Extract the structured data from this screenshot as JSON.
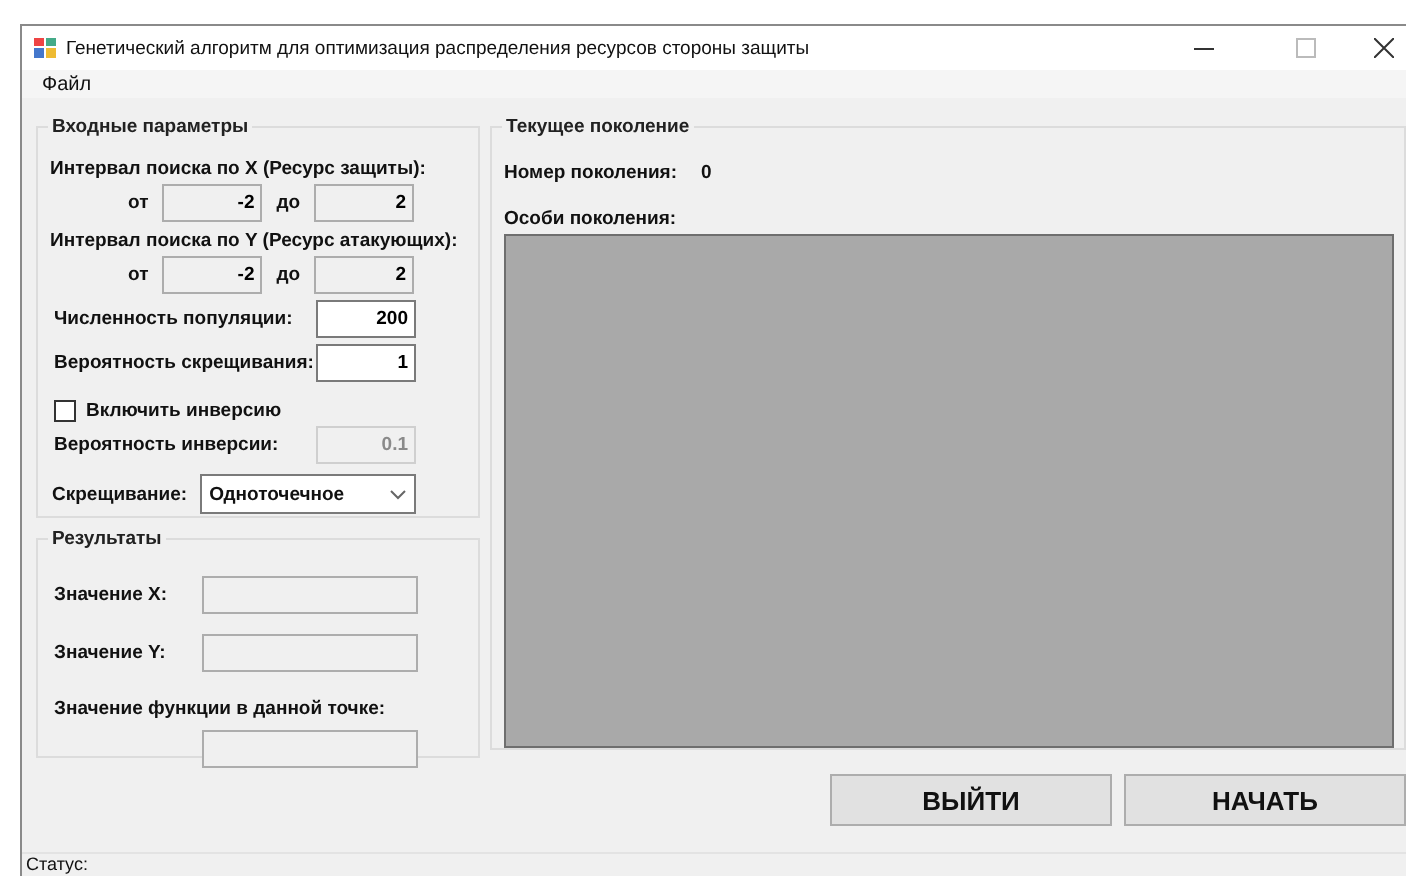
{
  "window": {
    "title": "Генетический алгоритм для оптимизация распределения ресурсов стороны защиты"
  },
  "menu": [
    {
      "label": "Файл"
    }
  ],
  "input_parameters": {
    "title": "Входные параметры",
    "intervals": [
      {
        "label": "Интервал поиска по X (Ресурс защиты):",
        "from_label": "от",
        "from": {
          "value": "-2",
          "readonly": true
        },
        "to_label": "до",
        "to": {
          "value": "2",
          "readonly": true
        }
      },
      {
        "label": "Интервал поиска по Y (Ресурс атакующих):",
        "from_label": "от",
        "from": {
          "value": "-2",
          "readonly": true
        },
        "to_label": "до",
        "to": {
          "value": "2",
          "readonly": true
        }
      }
    ],
    "population": {
      "label": "Численность популяции:",
      "value": "200",
      "readonly": false
    },
    "crossover_probability": {
      "label": "Вероятность скрещивания:",
      "value": "1",
      "readonly": false
    },
    "inversion": {
      "label": "Включить инверсию",
      "checked": false
    },
    "inversion_probability": {
      "label": "Вероятность инверсии:",
      "value": "0.1",
      "disabled": true
    },
    "crossover": {
      "label": "Скрещивание:",
      "value": "Одноточечное"
    }
  },
  "results": {
    "title": "Результаты",
    "fields": [
      {
        "label": "Значение X:",
        "readonly": true
      },
      {
        "label": "Значение Y:",
        "readonly": true
      },
      {
        "label": "Значение функции в данной точке:",
        "readonly": true
      }
    ]
  },
  "current_generation": {
    "title": "Текущее поколение",
    "number_label": "Номер поколения:",
    "number": "0",
    "individuals_label": "Особи поколения:"
  },
  "buttons": [
    {
      "label": "ВЫЙТИ"
    },
    {
      "label": "НАЧАТЬ"
    }
  ],
  "status_bar": {
    "label": "Статус:"
  }
}
